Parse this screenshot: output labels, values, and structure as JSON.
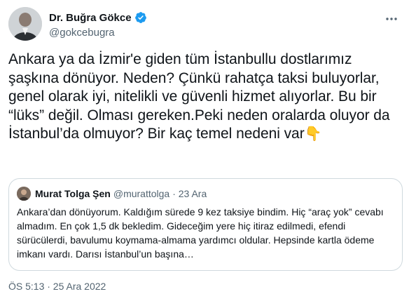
{
  "author": {
    "display_name": "Dr. Buğra Gökce",
    "handle": "@gokcebugra",
    "verified": true
  },
  "tweet": {
    "text": "Ankara ya da İzmir'e giden tüm İstanbullu dostlarımız şaşkına dönüyor. Neden? Çünkü rahatça taksi buluyorlar, genel olarak iyi, nitelikli ve güvenli hizmet alıyorlar. Bu bir “lüks” değil. Olması gereken.Peki neden oralarda oluyor da İstanbul’da olmuyor? Bir kaç temel nedeni var",
    "emoji": "👇"
  },
  "quoted_tweet": {
    "display_name": "Murat Tolga Şen",
    "handle": "@murattolga",
    "date": "· 23 Ara",
    "text": "Ankara’dan dönüyorum. Kaldığım sürede 9 kez taksiye bindim. Hiç “araç yok” cevabı almadım. En çok 1,5 dk bekledim. Gideceğim yere hiç itiraz edilmedi, efendi sürücülerdi, bavulumu koymama-almama yardımcı oldular. Hepsinde kartla ödeme imkanı vardı. Darısı İstanbul’un başına…"
  },
  "timestamp": "ÖS 5:13 · 25 Ara 2022",
  "colors": {
    "text": "#0f1419",
    "secondary": "#536471",
    "verified": "#1d9bf0",
    "border": "#cfd9de"
  },
  "icons": {
    "verified": "verified-badge-icon",
    "more": "more-dots-icon"
  }
}
